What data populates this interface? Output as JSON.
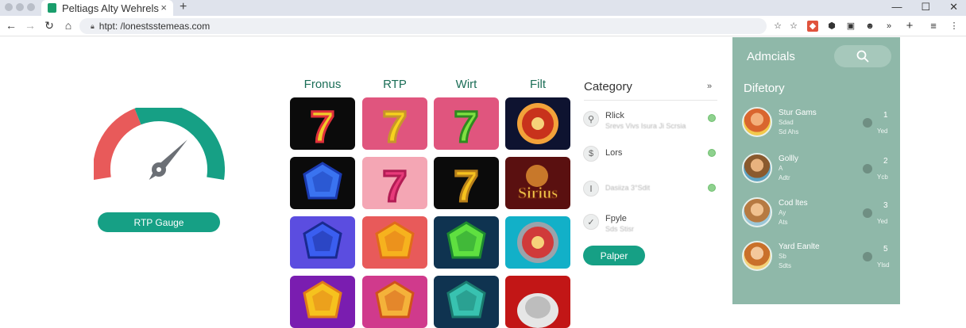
{
  "browser": {
    "tab_title": "Peltiags Alty Wehrels",
    "tab_close": "×",
    "new_tab": "+",
    "url": "htpt: /lonestsstemeas.com",
    "window_controls": [
      "—",
      "☐",
      "✕"
    ]
  },
  "gauge": {
    "button_label": "RTP Gauge",
    "value_fraction": 0.72,
    "colors": {
      "low": "#e85a5a",
      "high": "#16a085",
      "needle": "#6b6f75"
    }
  },
  "games": {
    "columns": [
      "Fronus",
      "RTP",
      "Wirt",
      "Filt"
    ],
    "tiles": [
      [
        "seven-neon-black",
        "seven-pink",
        "seven-green",
        "dragon-emblem"
      ],
      [
        "blue-gem-dark",
        "seven-light-pink",
        "seven-black-gold",
        "sirius-logo"
      ],
      [
        "blue-gem-purple",
        "orange-gem",
        "green-emerald",
        "red-target-emblem"
      ],
      [
        "orange-gem-purple",
        "star-pink",
        "teal-gem",
        "silver-dome"
      ]
    ],
    "tile_bgs": [
      [
        "#0b0b0b",
        "#e0557e",
        "#e0557e",
        "#0e1330"
      ],
      [
        "#0b0b0b",
        "#f4a6b4",
        "#0b0b0b",
        "#5a1010"
      ],
      [
        "#5b4de0",
        "#e85a5a",
        "#0f3350",
        "#12b0c8"
      ],
      [
        "#7a1db0",
        "#d03a8c",
        "#0f3350",
        "#c21616"
      ]
    ]
  },
  "category": {
    "title": "Category",
    "more": "»",
    "items": [
      {
        "label": "Rlick",
        "sub": "Srevs Vivs Isura Ji Scrsia",
        "icon": "⚲"
      },
      {
        "label": "Lors",
        "sub": "",
        "icon": "$"
      },
      {
        "label": "",
        "sub": "Dasiiza 3°Sdit",
        "icon": "Ⅰ"
      },
      {
        "label": "Fpyle",
        "sub": "Sds Stisr",
        "icon": "✓"
      }
    ],
    "button_label": "Palper"
  },
  "panel": {
    "title": "Admcials",
    "subtitle": "Difetory",
    "search_icon": "⚲",
    "items": [
      {
        "name": "Stur Gams",
        "l1": "Sdad",
        "l2": "Sd Ahs",
        "num": "1",
        "meta": "Yed"
      },
      {
        "name": "Gollly",
        "l1": "A",
        "l2": "Adtr",
        "num": "2",
        "meta": "Ycb"
      },
      {
        "name": "Cod ltes",
        "l1": "Ay",
        "l2": "Ats",
        "num": "3",
        "meta": "Yed"
      },
      {
        "name": "Yard Eanlte",
        "l1": "Sb",
        "l2": "Sdts",
        "num": "5",
        "meta": "Ylsd"
      }
    ]
  }
}
